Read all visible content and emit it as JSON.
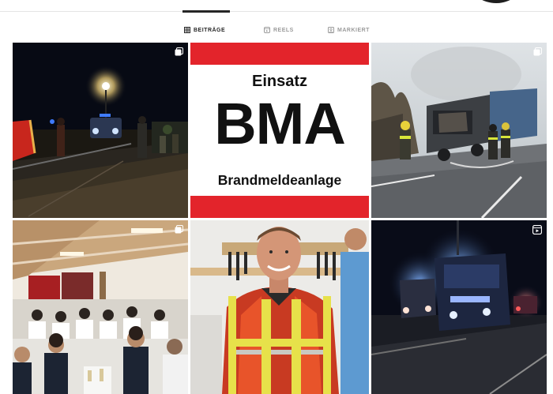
{
  "tabs": [
    {
      "label": "BEITRÄGE",
      "icon": "grid-icon",
      "active": true
    },
    {
      "label": "REELS",
      "icon": "reels-icon",
      "active": false
    },
    {
      "label": "MARKIERT",
      "icon": "tagged-icon",
      "active": false
    }
  ],
  "posts": [
    {
      "scene": "night-accident-scene",
      "badge": "multi-post-icon"
    },
    {
      "scene": "einsatz-bma-graphic",
      "badge": "",
      "text": {
        "line1": "Einsatz",
        "line2": "BMA",
        "line3": "Brandmeldeanlage"
      }
    },
    {
      "scene": "burned-truck-scene",
      "badge": "multi-post-icon"
    },
    {
      "scene": "banquet-hall-scene",
      "badge": "multi-post-icon"
    },
    {
      "scene": "firefighter-portrait",
      "badge": ""
    },
    {
      "scene": "night-fire-trucks-scene",
      "badge": "reel-icon"
    }
  ],
  "colors": {
    "accent_red": "#e3242b",
    "tab_active": "#262626",
    "tab_inactive": "#9b9b9b"
  }
}
